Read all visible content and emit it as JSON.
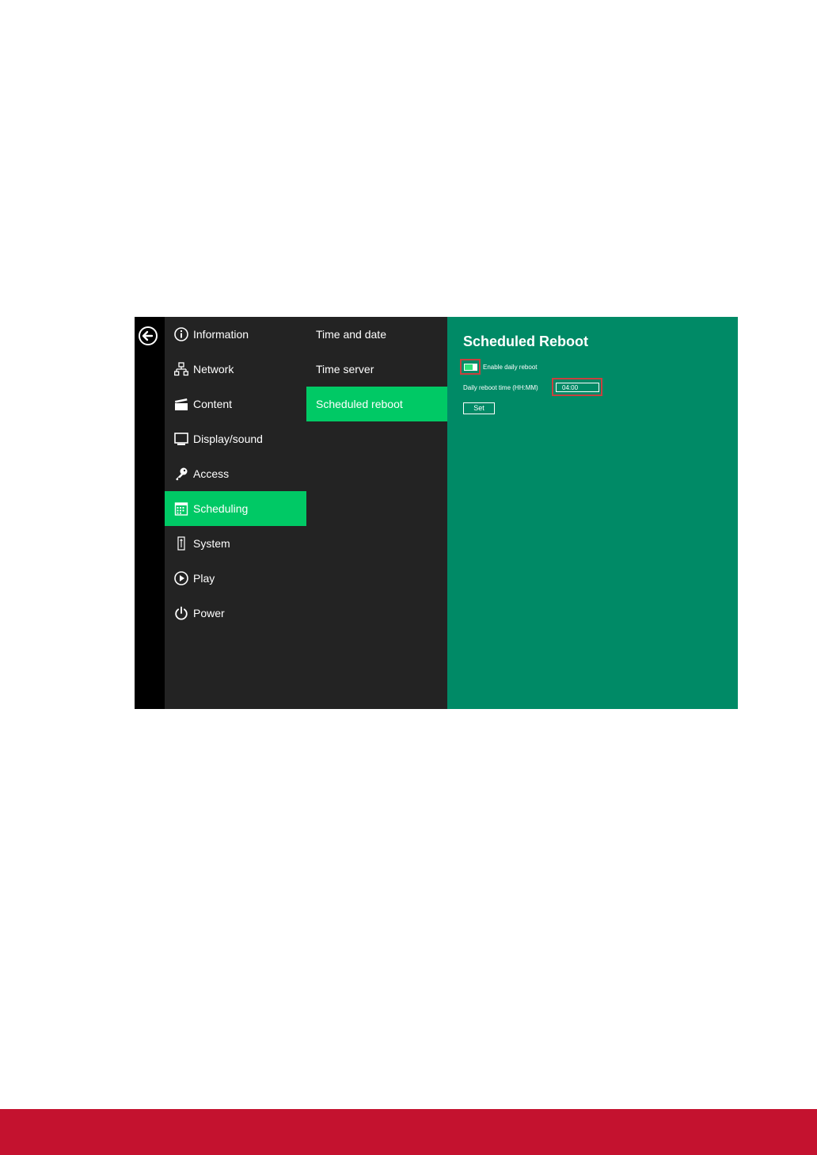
{
  "colors": {
    "accent": "#00c965",
    "panel": "#008a66",
    "menu_bg": "#232323",
    "footer": "#c4122f",
    "highlight_border": "#c8413f"
  },
  "back": {
    "icon": "back-arrow-icon"
  },
  "main_menu": {
    "items": [
      {
        "label": "Information",
        "icon": "info-icon"
      },
      {
        "label": "Network",
        "icon": "network-icon"
      },
      {
        "label": "Content",
        "icon": "clapperboard-icon"
      },
      {
        "label": "Display/sound",
        "icon": "monitor-icon"
      },
      {
        "label": "Access",
        "icon": "key-icon"
      },
      {
        "label": "Scheduling",
        "icon": "calendar-icon",
        "active": true
      },
      {
        "label": "System",
        "icon": "system-icon"
      },
      {
        "label": "Play",
        "icon": "play-icon"
      },
      {
        "label": "Power",
        "icon": "power-icon"
      }
    ]
  },
  "sub_menu": {
    "items": [
      {
        "label": "Time and date"
      },
      {
        "label": "Time server"
      },
      {
        "label": "Scheduled reboot",
        "active": true
      }
    ]
  },
  "panel": {
    "title": "Scheduled Reboot",
    "enable_label": "Enable daily reboot",
    "enable_on": true,
    "time_label": "Daily reboot time (HH:MM)",
    "time_value": "04:00",
    "set_label": "Set"
  }
}
